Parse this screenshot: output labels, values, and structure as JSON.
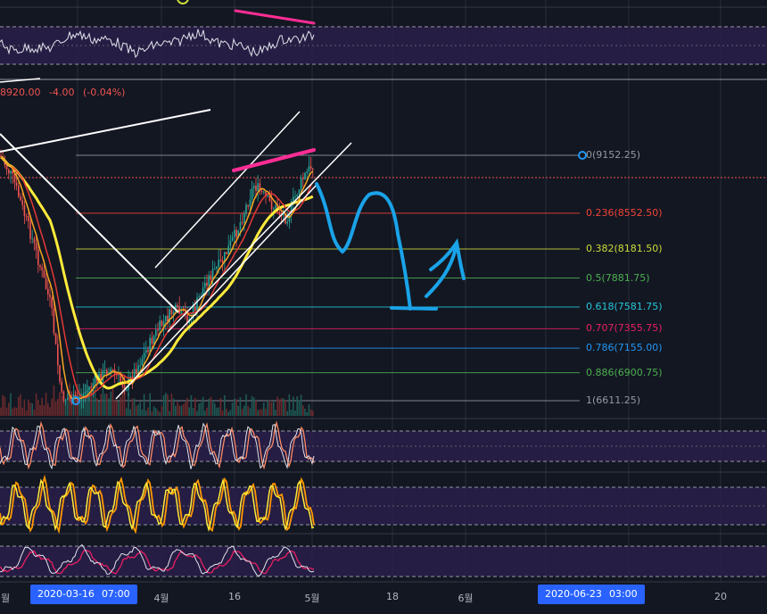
{
  "price_readout": {
    "close": "8920.00",
    "change": "-4.00",
    "change_pct": "(-0.04%)"
  },
  "colors": {
    "background": "#131722",
    "up": "#26a69a",
    "down": "#ef5350",
    "panel": "#2a1e4a",
    "ma_fast": "#f5a623",
    "ma_mid": "#e53935",
    "ma_slow": "#ffeb3b",
    "annotation_blue": "#1aa3e8",
    "annotation_pink": "#ff2d95"
  },
  "chart_data": {
    "type": "candlestick",
    "fibonacci_retracement": [
      {
        "level": "1",
        "price": "(6611.25)",
        "color": "#9598a1"
      },
      {
        "level": "0.886",
        "price": "(6900.75)",
        "color": "#4caf50"
      },
      {
        "level": "0.786",
        "price": "(7155.00)",
        "color": "#2196f3"
      },
      {
        "level": "0.707",
        "price": "(7355.75)",
        "color": "#e91e63"
      },
      {
        "level": "0.618",
        "price": "(7581.75)",
        "color": "#26c6da"
      },
      {
        "level": "0.5",
        "price": "(7881.75)",
        "color": "#4caf50"
      },
      {
        "level": "0.382",
        "price": "(8181.50)",
        "color": "#cddc39"
      },
      {
        "level": "0.236",
        "price": "(8552.50)",
        "color": "#f44336"
      },
      {
        "level": "0",
        "price": "(9152.25)",
        "color": "#9598a1"
      }
    ],
    "price_series": [
      {
        "x": "2020-02-26",
        "close": 9500
      },
      {
        "x": "2020-03-01",
        "close": 9200
      },
      {
        "x": "2020-03-04",
        "close": 8900
      },
      {
        "x": "2020-03-08",
        "close": 8200
      },
      {
        "x": "2020-03-11",
        "close": 7600
      },
      {
        "x": "2020-03-13",
        "close": 6650
      },
      {
        "x": "2020-03-16",
        "close": 6611
      },
      {
        "x": "2020-03-19",
        "close": 6800
      },
      {
        "x": "2020-03-22",
        "close": 6950
      },
      {
        "x": "2020-03-25",
        "close": 6750
      },
      {
        "x": "2020-03-28",
        "close": 7050
      },
      {
        "x": "2020-03-31",
        "close": 7350
      },
      {
        "x": "2020-04-03",
        "close": 7550
      },
      {
        "x": "2020-04-06",
        "close": 7450
      },
      {
        "x": "2020-04-09",
        "close": 7850
      },
      {
        "x": "2020-04-12",
        "close": 8050
      },
      {
        "x": "2020-04-15",
        "close": 8400
      },
      {
        "x": "2020-04-18",
        "close": 8850
      },
      {
        "x": "2020-04-21",
        "close": 8650
      },
      {
        "x": "2020-04-24",
        "close": 8500
      },
      {
        "x": "2020-04-27",
        "close": 8900
      },
      {
        "x": "2020-04-30",
        "close": 9152
      },
      {
        "x": "2020-05-01",
        "close": 8920
      }
    ],
    "x_ticks": [
      "월",
      "4월",
      "16",
      "5월",
      "18",
      "6월",
      "월",
      "20"
    ],
    "crosshair_labels": [
      {
        "date": "2020-03-16",
        "time": "07:00"
      },
      {
        "date": "2020-06-23",
        "time": "03:00"
      }
    ]
  }
}
